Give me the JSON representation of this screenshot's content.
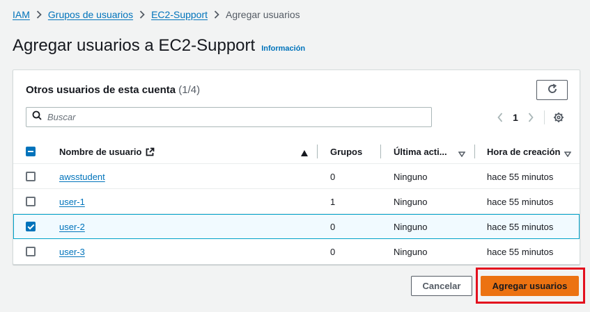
{
  "breadcrumb": {
    "items": [
      "IAM",
      "Grupos de usuarios",
      "EC2-Support"
    ],
    "current": "Agregar usuarios"
  },
  "page": {
    "title": "Agregar usuarios a EC2-Support",
    "info_link": "Información"
  },
  "panel": {
    "title": "Otros usuarios de esta cuenta",
    "count": "(1/4)",
    "refresh_icon": "refresh-icon",
    "search_placeholder": "Buscar",
    "search_value": "",
    "pagination": {
      "current_page": "1"
    }
  },
  "table": {
    "columns": [
      "Nombre de usuario",
      "Grupos",
      "Última acti...",
      "Hora de creación"
    ],
    "sort": {
      "column": "Nombre de usuario",
      "direction": "ascending"
    },
    "rows": [
      {
        "name": "awsstudent",
        "groups": "0",
        "last_activity": "Ninguno",
        "created": "hace 55 minutos",
        "selected": false
      },
      {
        "name": "user-1",
        "groups": "1",
        "last_activity": "Ninguno",
        "created": "hace 55 minutos",
        "selected": false
      },
      {
        "name": "user-2",
        "groups": "0",
        "last_activity": "Ninguno",
        "created": "hace 55 minutos",
        "selected": true
      },
      {
        "name": "user-3",
        "groups": "0",
        "last_activity": "Ninguno",
        "created": "hace 55 minutos",
        "selected": false
      }
    ]
  },
  "actions": {
    "cancel_label": "Cancelar",
    "submit_label": "Agregar usuarios"
  },
  "colors": {
    "link": "#0073bb",
    "primary_button": "#ec7211",
    "highlight": "#e3101e",
    "selected_row": "#f1faff"
  }
}
